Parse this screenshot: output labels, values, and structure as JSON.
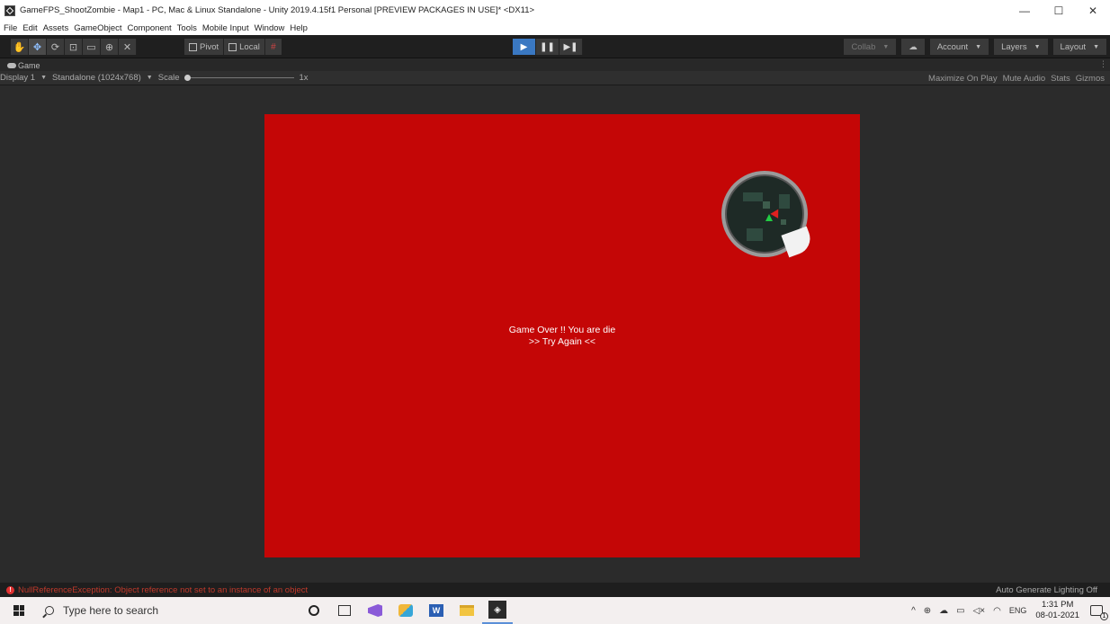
{
  "window": {
    "title": "GameFPS_ShootZombie - Map1 - PC, Mac & Linux Standalone - Unity 2019.4.15f1 Personal [PREVIEW PACKAGES IN USE]* <DX11>",
    "minimize": "—",
    "maximize": "☐",
    "close": "✕"
  },
  "menu": [
    "File",
    "Edit",
    "Assets",
    "GameObject",
    "Component",
    "Tools",
    "Mobile Input",
    "Window",
    "Help"
  ],
  "toolbar": {
    "pivot_label": "Pivot",
    "local_label": "Local",
    "play_icons": [
      "▶",
      "❚❚",
      "▶❚"
    ],
    "collab_label": "Collab",
    "account_label": "Account",
    "layers_label": "Layers",
    "layout_label": "Layout"
  },
  "tab": {
    "label": "Game"
  },
  "gamebar": {
    "display": "Display 1",
    "resolution": "Standalone (1024x768)",
    "scale_label": "Scale",
    "scale_value": "1x",
    "scale_fraction": 0,
    "maximize": "Maximize On Play",
    "mute": "Mute Audio",
    "stats": "Stats",
    "gizmos": "Gizmos"
  },
  "game": {
    "background_color": "#c40606",
    "line1": "Game Over !!  You are die",
    "line2": ">> Try Again <<"
  },
  "status": {
    "error_text": "NullReferenceException: Object reference not set to an instance of an object",
    "right_text": "Auto Generate Lighting Off"
  },
  "taskbar": {
    "search_placeholder": "Type here to search",
    "word_letter": "W",
    "language": "ENG",
    "time": "1:31 PM",
    "date": "08-01-2021",
    "notification_count": "1"
  }
}
